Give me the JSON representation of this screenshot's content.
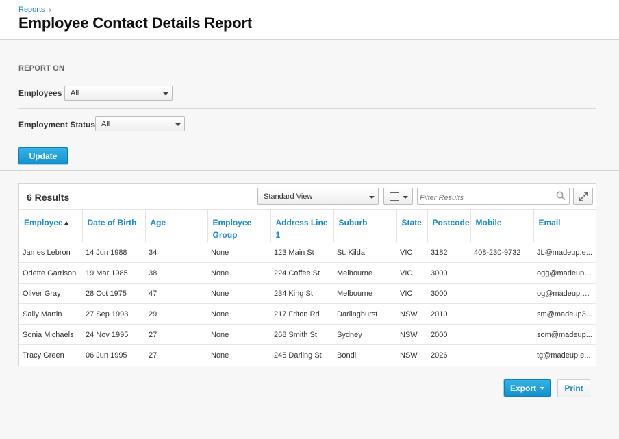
{
  "breadcrumb": {
    "parent": "Reports",
    "separator": "›"
  },
  "page": {
    "title": "Employee Contact Details Report"
  },
  "filters": {
    "section_label": "REPORT ON",
    "employees": {
      "label": "Employees",
      "value": "All"
    },
    "employment_status": {
      "label": "Employment Status",
      "value": "All"
    },
    "update_label": "Update"
  },
  "results": {
    "count_label": "6 Results",
    "view": "Standard View",
    "filter_placeholder": "Filter Results",
    "columns": [
      "Employee",
      "Date of Birth",
      "Age",
      "Employee Group",
      "Address Line 1",
      "Suburb",
      "State",
      "Postcode",
      "Mobile",
      "Email"
    ],
    "sorted_column": "Employee",
    "rows": [
      [
        "James Lebron",
        "14 Jun 1988",
        "34",
        "None",
        "123 Main St",
        "St. Kilda",
        "VIC",
        "3182",
        "408-230-9732",
        "JL@madeup.e..."
      ],
      [
        "Odette Garrison",
        "19 Mar 1985",
        "38",
        "None",
        "224 Coffee St",
        "Melbourne",
        "VIC",
        "3000",
        "",
        "ogg@madeup...."
      ],
      [
        "Oliver Gray",
        "28 Oct 1975",
        "47",
        "None",
        "234 King St",
        "Melbourne",
        "VIC",
        "3000",
        "",
        "og@madeup.e..."
      ],
      [
        "Sally Martin",
        "27 Sep 1993",
        "29",
        "None",
        "217 Friton Rd",
        "Darlinghurst",
        "NSW",
        "2010",
        "",
        "sm@madeup3..."
      ],
      [
        "Sonia Michaels",
        "24 Nov 1995",
        "27",
        "None",
        "268 Smith St",
        "Sydney",
        "NSW",
        "2000",
        "",
        "som@madeup..."
      ],
      [
        "Tracy Green",
        "06 Jun 1995",
        "27",
        "None",
        "245 Darling St",
        "Bondi",
        "NSW",
        "2026",
        "",
        "tg@madeup.e..."
      ]
    ]
  },
  "actions": {
    "export_label": "Export",
    "print_label": "Print"
  },
  "colors": {
    "accent": "#1a8bc9",
    "primary_button": "#1e9fd8"
  }
}
